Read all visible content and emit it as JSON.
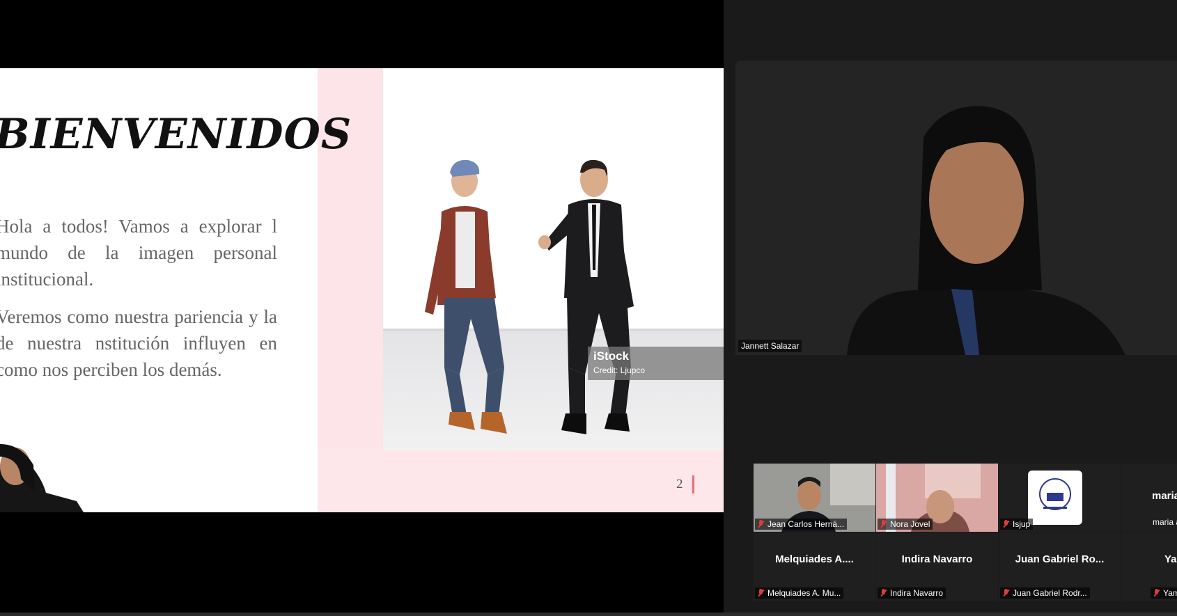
{
  "slide": {
    "title": "BIENVENIDOS",
    "paragraph_1": "Hola a todos! Vamos a explorar l mundo de la imagen personal institucional.",
    "paragraph_2": "Veremos como nuestra pariencia y la de nuestra nstitución influyen en como nos perciben los demás.",
    "photo_watermark": "iStock",
    "photo_credit": "Credit: Ljupco",
    "page_number": "2",
    "colors": {
      "pink": "#fde7ea",
      "accent": "#e86d7d"
    }
  },
  "main_video": {
    "name": "Jannett Salazar"
  },
  "participants_row_1": [
    {
      "label": "Jean Carlos Herná...",
      "muted": true
    },
    {
      "label": "Nora Jovel",
      "muted": true
    },
    {
      "label": "Isjup",
      "muted": true
    },
    {
      "big_name": "maria",
      "label": "maria alvarez",
      "muted": false
    }
  ],
  "participants_row_2": [
    {
      "big_name": "Melquiades A....",
      "label": "Melquiades A. Mu...",
      "muted": true
    },
    {
      "big_name": "Indira Navarro",
      "label": "Indira Navarro",
      "muted": true
    },
    {
      "big_name": "Juan Gabriel Ro...",
      "label": "Juan Gabriel Rodr...",
      "muted": true
    },
    {
      "big_name": "Yamilet",
      "label": "Yamileth S",
      "muted": true
    }
  ]
}
